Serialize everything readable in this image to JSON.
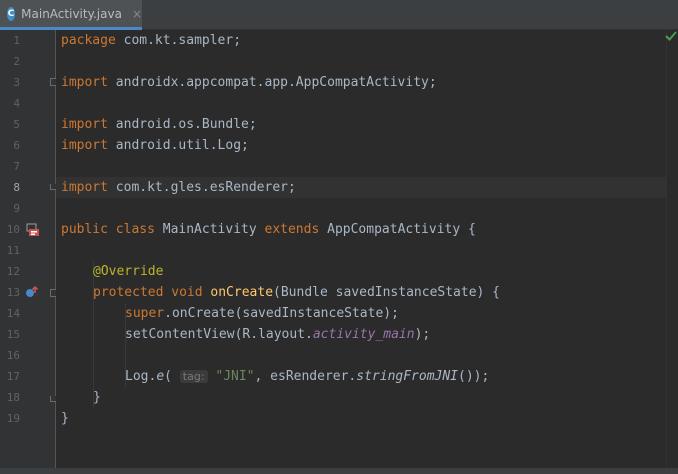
{
  "tab": {
    "file_icon_letter": "C",
    "label": "MainActivity.java",
    "close": "×"
  },
  "gutter": {
    "line_numbers": [
      "1",
      "2",
      "3",
      "4",
      "5",
      "6",
      "7",
      "8",
      "9",
      "10",
      "11",
      "12",
      "13",
      "14",
      "15",
      "16",
      "17",
      "18",
      "19"
    ],
    "current_line": 8
  },
  "code": {
    "l1_kw": "package",
    "l1_rest": " com.kt.sampler;",
    "l3_kw": "import",
    "l3_rest": " androidx.appcompat.app.AppCompatActivity;",
    "l5_kw": "import",
    "l5_rest": " android.os.Bundle;",
    "l6_kw": "import",
    "l6_rest": " android.util.Log;",
    "l8_kw": "import",
    "l8_rest": " com.kt.gles.esRenderer;",
    "l10_kw1": "public class",
    "l10_name": " MainActivity ",
    "l10_kw2": "extends",
    "l10_rest": " AppCompatActivity {",
    "l12_ann": "@Override",
    "l13_kw": "protected void",
    "l13_sp": " ",
    "l13_fn": "onCreate",
    "l13_rest": "(Bundle savedInstanceState) {",
    "l14_kw": "super",
    "l14_rest": ".onCreate(savedInstanceState);",
    "l15_pre": "setContentView(R.layout.",
    "l15_field": "activity_main",
    "l15_post": ");",
    "l17_pre": "Log.",
    "l17_method": "e",
    "l17_open": "( ",
    "l17_hint": "tag:",
    "l17_sp": " ",
    "l17_str": "\"JNI\"",
    "l17_mid": ", esRenderer.",
    "l17_method2": "stringFromJNI",
    "l17_post": "());",
    "l18": "}",
    "l19": "}"
  },
  "status": {
    "inspection_icon": "check-icon",
    "inspection_color": "#499c54"
  },
  "colors": {
    "keyword": "#cc7832",
    "annotation": "#bbb529",
    "method": "#ffc66d",
    "string": "#6a8759",
    "field": "#9876aa",
    "text": "#a9b7c6",
    "tab_underline": "#4a88c7"
  }
}
